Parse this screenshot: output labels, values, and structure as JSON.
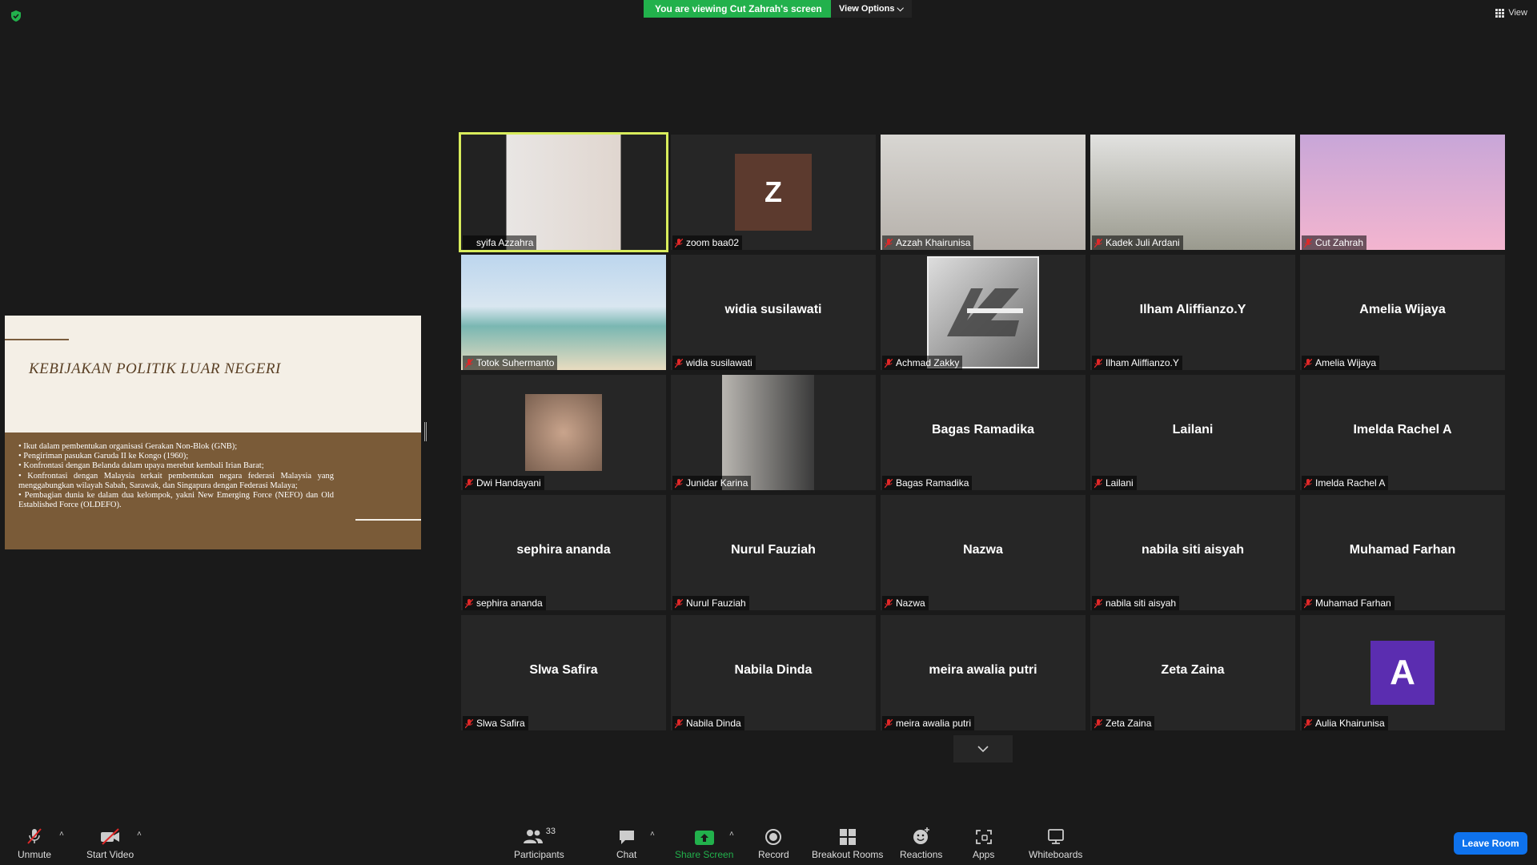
{
  "top": {
    "banner": "You are viewing Cut Zahrah's screen",
    "view_options": "View Options",
    "view": "View"
  },
  "slide": {
    "title": "KEBIJAKAN POLITIK LUAR NEGERI",
    "bullets": [
      "• Ikut dalam pembentukan organisasi Gerakan Non-Blok (GNB);",
      "• Pengiriman pasukan Garuda II ke Kongo (1960);",
      "• Konfrontasi dengan Belanda dalam upaya merebut kembali Irian Barat;",
      "• Konfrontasi dengan Malaysia terkait pembentukan negara federasi Malaysia yang menggabungkan wilayah Sabah, Sarawak, dan Singapura dengan Federasi Malaya;",
      "• Pembagian dunia ke dalam dua kelompok, yakni New Emerging Force (NEFO) dan Old Established Force (OLDEFO)."
    ]
  },
  "participants": [
    {
      "name": "syifa Azzahra",
      "kind": "video",
      "active": true
    },
    {
      "name": "zoom baa02",
      "kind": "avatar",
      "letter": "Z",
      "color": "#5c3a2e"
    },
    {
      "name": "Azzah Khairunisa",
      "kind": "video"
    },
    {
      "name": "Kadek Juli Ardani",
      "kind": "video"
    },
    {
      "name": "Cut Zahrah",
      "kind": "video"
    },
    {
      "name": "Totok Suhermanto",
      "kind": "video"
    },
    {
      "name": "widia susilawati",
      "kind": "name",
      "display": "widia susilawati"
    },
    {
      "name": "Achmad Zakky",
      "kind": "logo"
    },
    {
      "name": "Ilham Aliffianzo.Y",
      "kind": "name",
      "display": "Ilham Aliffianzo.Y"
    },
    {
      "name": "Amelia Wijaya",
      "kind": "name",
      "display": "Amelia Wijaya"
    },
    {
      "name": "Dwi Handayani",
      "kind": "photo"
    },
    {
      "name": "Junidar Karina",
      "kind": "video"
    },
    {
      "name": "Bagas Ramadika",
      "kind": "name",
      "display": "Bagas Ramadika"
    },
    {
      "name": "Lailani",
      "kind": "name",
      "display": "Lailani"
    },
    {
      "name": "Imelda Rachel A",
      "kind": "name",
      "display": "Imelda Rachel A"
    },
    {
      "name": "sephira ananda",
      "kind": "name",
      "display": "sephira ananda"
    },
    {
      "name": "Nurul Fauziah",
      "kind": "name",
      "display": "Nurul Fauziah"
    },
    {
      "name": "Nazwa",
      "kind": "name",
      "display": "Nazwa"
    },
    {
      "name": "nabila siti aisyah",
      "kind": "name",
      "display": "nabila siti aisyah"
    },
    {
      "name": "Muhamad Farhan",
      "kind": "name",
      "display": "Muhamad Farhan"
    },
    {
      "name": "Slwa Safira",
      "kind": "name",
      "display": "Slwa Safira"
    },
    {
      "name": "Nabila Dinda",
      "kind": "name",
      "display": "Nabila Dinda"
    },
    {
      "name": "meira awalia putri",
      "kind": "name",
      "display": "meira awalia putri"
    },
    {
      "name": "Zeta Zaina",
      "kind": "name",
      "display": "Zeta Zaina"
    },
    {
      "name": "Aulia Khairunisa",
      "kind": "avatar",
      "letter": "A",
      "color": "#5b2db0"
    }
  ],
  "toolbar": {
    "unmute": "Unmute",
    "start_video": "Start Video",
    "participants": "Participants",
    "participants_count": "33",
    "chat": "Chat",
    "share_screen": "Share Screen",
    "record": "Record",
    "breakout_rooms": "Breakout Rooms",
    "reactions": "Reactions",
    "apps": "Apps",
    "whiteboards": "Whiteboards",
    "leave_room": "Leave Room"
  },
  "colors": {
    "share_green": "#22b14c",
    "leave_blue": "#0e72ed",
    "active_speaker": "#d8ec5c",
    "muted_red": "#e02828"
  }
}
